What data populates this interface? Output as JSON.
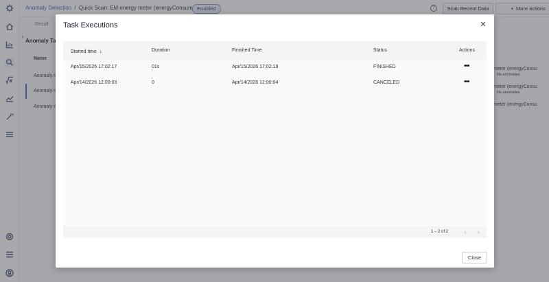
{
  "header": {
    "breadcrumb_link": "Anomaly Detection",
    "breadcrumb_sep": "/",
    "breadcrumb_current": "Quick Scan: EM energy meter (energyConsumption)",
    "status_badge": "Enabled",
    "help_icon": "?",
    "scan_button": "Scan Recent Data",
    "more_actions_dot": "●",
    "more_actions_button": "More actions"
  },
  "sidebar": {
    "icons": [
      "app-logo-icon",
      "home-icon",
      "bar-chart-icon",
      "search-icon",
      "formula-icon",
      "trend-icon",
      "magic-wand-icon",
      "menu-icon",
      "settings-icon",
      "filter-settings-icon",
      "user-icon"
    ],
    "expander": "›"
  },
  "background": {
    "tab": "Result",
    "section_title": "Anomaly Task",
    "column_name": "Name",
    "rows": [
      "Anomaly me",
      "Anomaly me",
      "Anomaly me"
    ],
    "right_rows": [
      {
        "title": "meter (energyConsu",
        "sub": "No anomalies"
      },
      {
        "title": "meter (energyConsu",
        "sub": "No anomalies"
      },
      {
        "title": "meter (energyConsu",
        "sub": ""
      }
    ]
  },
  "modal": {
    "title": "Task Executions",
    "close_icon": "✕",
    "columns": {
      "started": "Started time",
      "sort_icon": "↓",
      "duration": "Duration",
      "finished": "Finished Time",
      "status": "Status",
      "actions": "Actions"
    },
    "rows": [
      {
        "started": "Apr/15/2026 17:02:17",
        "duration": "01s",
        "finished": "Apr/15/2026 17:02:19",
        "status": "FINISHED",
        "menu": "•••"
      },
      {
        "started": "Apr/14/2026 12:00:03",
        "duration": "0",
        "finished": "Apr/14/2026 12:00:04",
        "status": "CANCELED",
        "menu": "•••"
      }
    ],
    "pager": {
      "text": "1 – 2 of 2",
      "prev": "‹",
      "next": "›"
    },
    "close_button": "Close"
  }
}
